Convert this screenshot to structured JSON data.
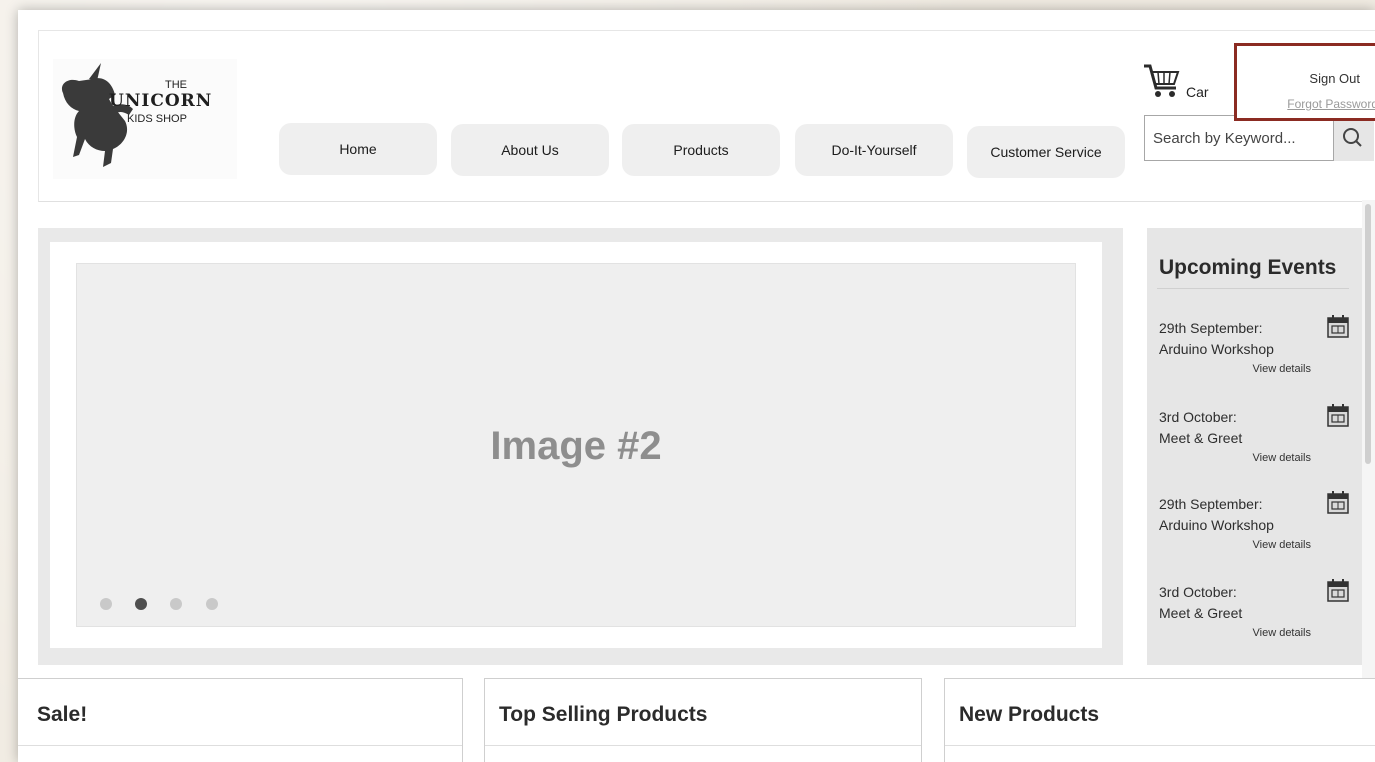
{
  "logo": {
    "line1": "THE",
    "line2": "UNICORN",
    "line3": "KIDS SHOP"
  },
  "nav": [
    {
      "label": "Home"
    },
    {
      "label": "About Us"
    },
    {
      "label": "Products"
    },
    {
      "label": "Do-It-Yourself"
    },
    {
      "label": "Customer Service"
    }
  ],
  "cart": {
    "label": "Car"
  },
  "account": {
    "sign_out": "Sign Out",
    "forgot_password": "Forgot Password"
  },
  "search": {
    "placeholder": "Search by Keyword..."
  },
  "hero": {
    "label": "Image #2",
    "slide_count": 4,
    "active_slide": 2
  },
  "events": {
    "title": "Upcoming Events",
    "items": [
      {
        "date": "29th September:",
        "name": "Arduino Workshop",
        "link": "View details"
      },
      {
        "date": "3rd October:",
        "name": "Meet & Greet",
        "link": "View details"
      },
      {
        "date": "29th September:",
        "name": "Arduino Workshop",
        "link": "View details"
      },
      {
        "date": "3rd October:",
        "name": "Meet & Greet",
        "link": "View details"
      }
    ]
  },
  "panels": [
    {
      "title": "Sale!"
    },
    {
      "title": "Top Selling Products"
    },
    {
      "title": "New Products"
    }
  ],
  "colors": {
    "highlight_border": "#8b2b22",
    "nav_bg": "#efefef",
    "panel_bg": "#e6e6e6"
  }
}
